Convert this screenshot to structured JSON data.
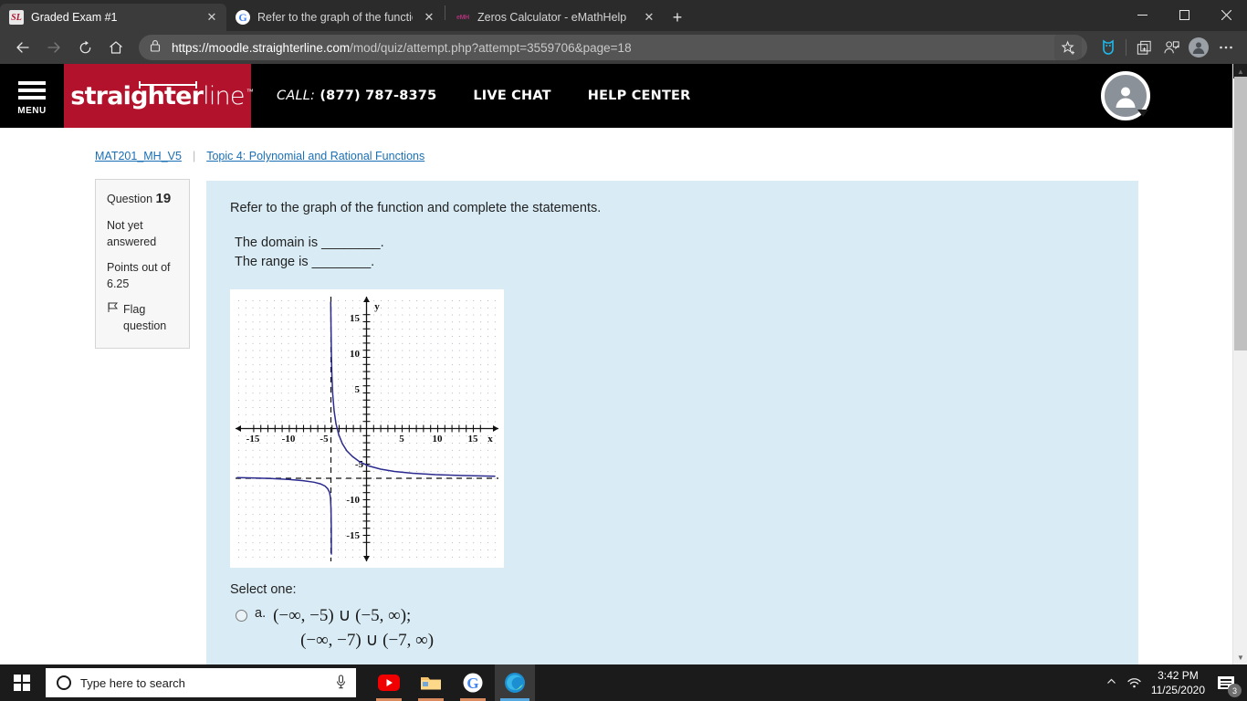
{
  "browser": {
    "tabs": [
      {
        "title": "Graded Exam #1",
        "favicon": "straighterline-favicon",
        "active": true,
        "close_label": "✕"
      },
      {
        "title": "Refer to the graph of the functio",
        "favicon": "google-favicon",
        "active": false,
        "close_label": "✕"
      },
      {
        "title": "Zeros Calculator - eMathHelp",
        "favicon": "emathhelp-favicon",
        "active": false,
        "close_label": "✕"
      }
    ],
    "newtab_label": "+",
    "window_controls": {
      "minimize": "—",
      "maximize": "❐",
      "close": "✕"
    },
    "nav": {
      "back": "←",
      "forward": "→",
      "refresh": "↻",
      "home": "⌂"
    },
    "url": {
      "scheme_host": "https://moodle.straighterline.com",
      "path": "/mod/quiz/attempt.php?attempt=3559706&page=18",
      "full": "https://moodle.straighterline.com/mod/quiz/attempt.php?attempt=3559706&page=18"
    },
    "url_actions": [
      "favorites-star-icon",
      "microsoft-editor-icon",
      "collections-icon",
      "share-profile-icon",
      "profile-avatar-icon",
      "settings-more-icon"
    ]
  },
  "site_header": {
    "menu_label": "MENU",
    "logo_bold": "straighter",
    "logo_light": "line",
    "logo_tm": "™",
    "nav": [
      {
        "prefix": "CALL:",
        "label": "(877) 787-8375",
        "name": "call-phone"
      },
      {
        "prefix": "",
        "label": "LIVE CHAT",
        "name": "live-chat"
      },
      {
        "prefix": "",
        "label": "HELP CENTER",
        "name": "help-center"
      }
    ]
  },
  "breadcrumb": {
    "course": "MAT201_MH_V5",
    "separator": "|",
    "topic": "Topic 4: Polynomial and Rational Functions"
  },
  "question_info": {
    "question_label": "Question",
    "question_number": "19",
    "status": "Not yet answered",
    "points_label": "Points out of",
    "points_value": "6.25",
    "flag_label": "Flag question",
    "flag_icon": "flag-icon"
  },
  "question": {
    "stem": "Refer to the graph of the function and complete the statements.",
    "statement_domain": "The domain is ________.",
    "statement_range": "The range is ________.",
    "select_one": "Select one:",
    "options": [
      {
        "letter": "a.",
        "line1": "(−∞, −5) ∪ (−5, ∞);",
        "line2": "(−∞, −7) ∪ (−7, ∞)",
        "selected": false
      }
    ]
  },
  "chart_data": {
    "type": "line",
    "title": "",
    "xlabel": "x",
    "ylabel": "y",
    "xlim": [
      -17.5,
      17.5
    ],
    "ylim": [
      -17.5,
      17.5
    ],
    "xticks": [
      -15,
      -10,
      -5,
      5,
      10,
      15
    ],
    "yticks": [
      15,
      10,
      5,
      -5,
      -10,
      -15
    ],
    "grid": "dotted",
    "grid_spacing": 1,
    "curve_color": "#2b2b8f",
    "asymptotes": [
      {
        "type": "vertical",
        "value": -5,
        "style": "dashed"
      },
      {
        "type": "horizontal",
        "value": -7,
        "style": "dashed"
      }
    ],
    "function": "y = 2/(x+5) - 7",
    "branches": [
      {
        "name": "left-branch",
        "x_range": [
          -17.0,
          -5.12
        ],
        "description": "approaches y = -7 from below as x -> -inf; drops to -inf as x -> -5 from left"
      },
      {
        "name": "right-branch",
        "x_range": [
          -4.88,
          17.0
        ],
        "description": "comes down from +inf at x -> -5 from right; approaches y = -7 from above as x -> +inf"
      }
    ],
    "sample_points": [
      {
        "x": -17.0,
        "y": -7.17
      },
      {
        "x": -15.0,
        "y": -7.2
      },
      {
        "x": -12.0,
        "y": -7.29
      },
      {
        "x": -10.0,
        "y": -7.4
      },
      {
        "x": -8.0,
        "y": -7.67
      },
      {
        "x": -7.0,
        "y": -8.0
      },
      {
        "x": -6.0,
        "y": -9.0
      },
      {
        "x": -5.5,
        "y": -11.0
      },
      {
        "x": -5.2,
        "y": -17.0
      },
      {
        "x": -4.8,
        "y": 3.0
      },
      {
        "x": -4.6,
        "y": -2.0
      },
      {
        "x": -4.0,
        "y": -5.0
      },
      {
        "x": -3.0,
        "y": -6.0
      },
      {
        "x": -1.0,
        "y": -6.5
      },
      {
        "x": 2.0,
        "y": -6.71
      },
      {
        "x": 5.0,
        "y": -6.8
      },
      {
        "x": 10.0,
        "y": -6.87
      },
      {
        "x": 15.0,
        "y": -6.9
      },
      {
        "x": 17.0,
        "y": -6.91
      }
    ]
  },
  "taskbar": {
    "start_icon": "windows-start-icon",
    "search_placeholder": "Type here to search",
    "search_icon": "cortana-circle-icon",
    "mic_icon": "microphone-icon",
    "apps": [
      {
        "name": "youtube-icon",
        "running": true
      },
      {
        "name": "file-explorer-icon",
        "running": true
      },
      {
        "name": "google-chrome-icon",
        "running": true
      },
      {
        "name": "microsoft-edge-icon",
        "running": true,
        "active": true
      }
    ],
    "tray": {
      "show_hidden_icon": "chevron-up-icon",
      "network_icon": "wifi-icon",
      "time": "3:42 PM",
      "date": "11/25/2020",
      "notification_icon": "action-center-icon",
      "notification_count": "3"
    }
  },
  "colors": {
    "brand_red": "#b3122c",
    "link_blue": "#1a6fb5",
    "question_bg": "#d9ecf5",
    "curve": "#2b2b8f",
    "taskbar": "#1b1b1b"
  }
}
